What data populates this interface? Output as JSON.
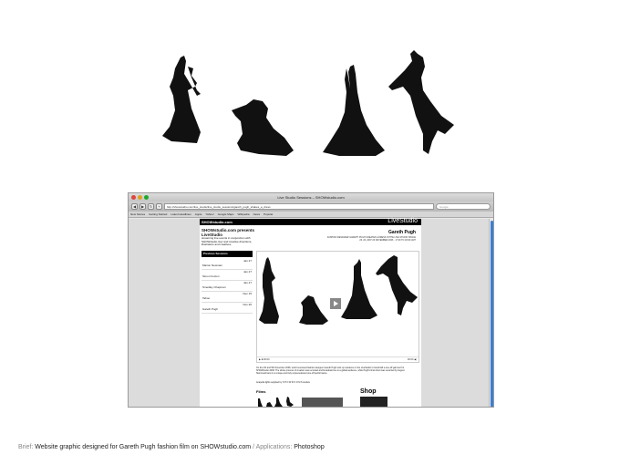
{
  "browser": {
    "window_title": "Live Studio Sessions – SHOWstudio.com",
    "url": "http://showstudio.com/live_studio/live_studio_sessions/gareth_pugh_shakes_a_dress",
    "search_placeholder": "Google",
    "bookmarks": [
      "New Stories",
      "Getting Started",
      "Latest Headlines",
      "Apple",
      "Yahoo!",
      "Google Maps",
      "Wikipedia",
      "News",
      "Popular"
    ],
    "accent_color": "#3b7fd6"
  },
  "site": {
    "logo": "SHOWstudio.com",
    "header_title": "LiveStudio",
    "presents_title": "SHOWstudio.com presents LiveStudio",
    "presents_body": "streaming live events in conjunction with SHOWstudio live! and creative directions, illustrators and creatives",
    "feature_title": "Gareth Pugh",
    "feature_subtitle": "FASHION DESIGNER GARETH PUGH CREATES A DRESS IN THE LIVE STUDIO SPACE",
    "feature_date": "26, 20, 2007 26 NOVEMBER 2006 · 17:00 TO 18:00 GMT",
    "previous_sessions_label": "Previous Sessions",
    "previous_sessions": [
      {
        "name": "Marion Newman",
        "date": "Jan 27"
      },
      {
        "name": "Simon Foxton",
        "date": "Jan 27"
      },
      {
        "name": "Smedley Chapman",
        "date": "Jan 27"
      },
      {
        "name": "Taboo",
        "date": "Dec 15"
      },
      {
        "name": "Gareth Pugh",
        "date": "Nov 26"
      }
    ],
    "player_time_left": "00:00",
    "player_time_right": "00:00 ◀)",
    "description": "On the 4th and 5th November 2006, world renowned fashion designer Gareth Pugh took up residence in the LiveStudio to handcraft a one-off garment for SHOWstudio 2006. The whole process of creation was recorded and broadcast live to a global audience, while Pugh's final shoot was recorded by August Steinmetzmann in a unique and truly unprecedented one-off performance.",
    "credits": "Acapella lights supplied by S  H  O  W  R  O  O  M  S  studios",
    "films_label": "Films",
    "shop_label": "Shop",
    "films_captions": [
      "PERFORMANCE",
      "PROCESS"
    ]
  },
  "caption": {
    "brief_label": "Brief:",
    "brief_text": "Website graphic designed for Gareth Pugh fashion film on SHOWstudio.com",
    "separator": "/",
    "applications_label": "Applications:",
    "applications_text": "Photoshop"
  }
}
